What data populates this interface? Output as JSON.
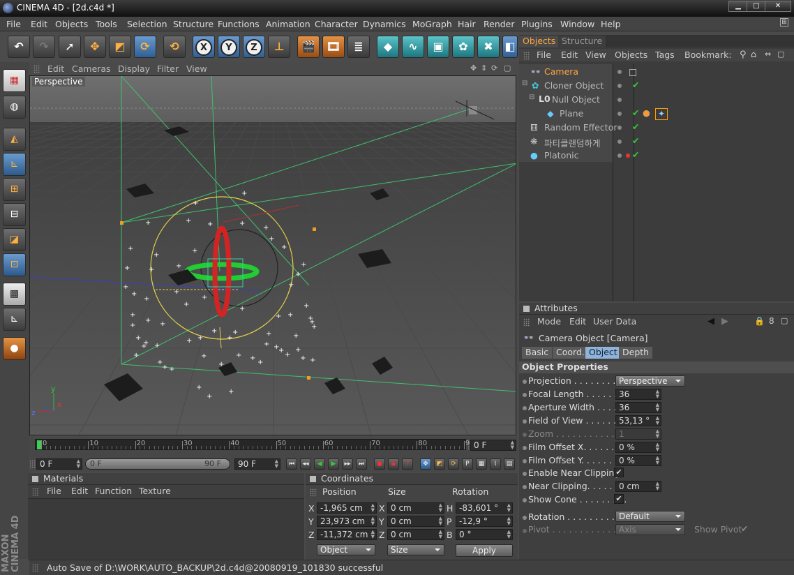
{
  "app": {
    "title": "CINEMA 4D - [2d.c4d *]"
  },
  "menu": [
    "File",
    "Edit",
    "Objects",
    "Tools",
    "Selection",
    "Structure",
    "Functions",
    "Animation",
    "Character",
    "Dynamics",
    "MoGraph",
    "Hair",
    "Render",
    "Plugins",
    "Window",
    "Help"
  ],
  "toolbar": {
    "axis_x": "X",
    "axis_y": "Y",
    "axis_z": "Z"
  },
  "viewport": {
    "menu": [
      "Edit",
      "Cameras",
      "Display",
      "Filter",
      "View"
    ],
    "label": "Perspective",
    "axis_x": "x",
    "axis_y": "y",
    "axis_z": "z"
  },
  "timeline": {
    "ticks": [
      "0",
      "10",
      "20",
      "30",
      "40",
      "50",
      "60",
      "70",
      "80",
      "90"
    ],
    "current_frame": "0 F",
    "start": "0 F",
    "range_start": "0 F",
    "range_end": "90 F",
    "end": "90 F"
  },
  "materials": {
    "title": "Materials",
    "menu": [
      "File",
      "Edit",
      "Function",
      "Texture"
    ]
  },
  "coordinates": {
    "title": "Coordinates",
    "headers": [
      "Position",
      "Size",
      "Rotation"
    ],
    "rows": [
      {
        "a": "X",
        "pos": "-1,965 cm",
        "b": "X",
        "size": "0 cm",
        "c": "H",
        "rot": "-83,601 °"
      },
      {
        "a": "Y",
        "pos": "23,973 cm",
        "b": "Y",
        "size": "0 cm",
        "c": "P",
        "rot": "-12,9 °"
      },
      {
        "a": "Z",
        "pos": "-11,372 cm",
        "b": "Z",
        "size": "0 cm",
        "c": "B",
        "rot": "0 °"
      }
    ],
    "mode_object": "Object",
    "mode_size": "Size",
    "apply": "Apply"
  },
  "status": "Auto Save of D:\\WORK\\AUTO_BACKUP\\2d.c4d@20080919_101830 successful",
  "objects_panel": {
    "tabs": [
      "Objects",
      "Structure"
    ],
    "menu": [
      "File",
      "Edit",
      "View",
      "Objects",
      "Tags",
      "Bookmark:"
    ],
    "items": [
      {
        "name": "Camera",
        "color": "#ffa640"
      },
      {
        "name": "Cloner Object",
        "color": "#b8b8b8"
      },
      {
        "name": "Null Object",
        "color": "#b8b8b8"
      },
      {
        "name": "Plane",
        "color": "#b8b8b8"
      },
      {
        "name": "Random Effector",
        "color": "#b8b8b8"
      },
      {
        "name": "파티클랜덤하게",
        "color": "#b8b8b8"
      },
      {
        "name": "Platonic",
        "color": "#b8b8b8"
      }
    ]
  },
  "attributes": {
    "title": "Attributes",
    "menu": [
      "Mode",
      "Edit",
      "User Data"
    ],
    "object_title": "Camera Object [Camera]",
    "tabs": [
      "Basic",
      "Coord.",
      "Object",
      "Depth"
    ],
    "section": "Object Properties",
    "props": [
      {
        "label": "Projection . . . . . . . . . . .",
        "value": "Perspective"
      },
      {
        "label": "Focal Length . . . . . . . .",
        "value": "36"
      },
      {
        "label": "Aperture Width . . . . . .",
        "value": "36"
      },
      {
        "label": "Field of View . . . . . . . .",
        "value": "53,13 °"
      },
      {
        "label": "Zoom . . . . . . . . . . . . . . .",
        "value": "1"
      },
      {
        "label": "Film Offset X. . . . . . . .",
        "value": "0 %"
      },
      {
        "label": "Film Offset Y. . . . . . . .",
        "value": "0 %"
      },
      {
        "label": "Enable Near Clipping",
        "value": "✔"
      },
      {
        "label": "Near Clipping. . . . . . . .",
        "value": "0 cm"
      },
      {
        "label": "Show Cone . . . . . . . . .",
        "value": "✔"
      },
      {
        "label": "Rotation . . . . . . . . . . . .",
        "value": "Default"
      },
      {
        "label": "Pivot . . . . . . . . . . . . . .",
        "value": "Axis"
      }
    ],
    "show_pivot": "Show Pivot"
  }
}
